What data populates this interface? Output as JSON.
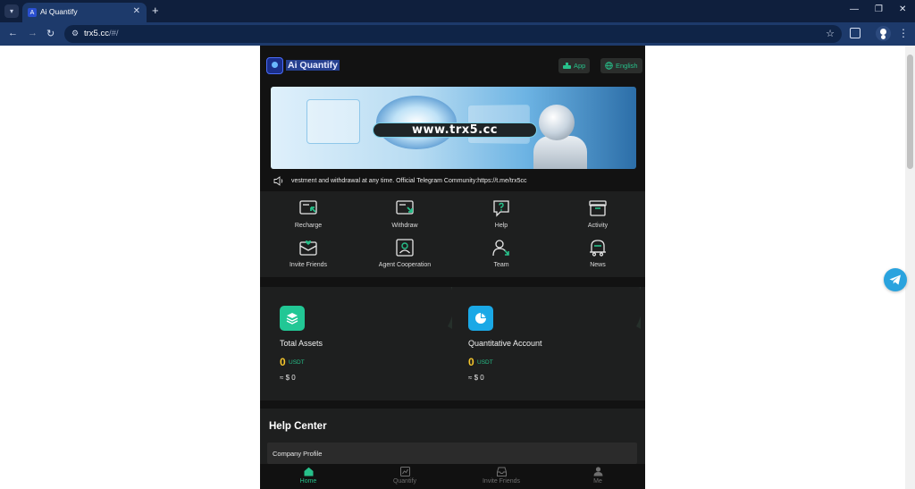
{
  "browser": {
    "tab_title": "Ai Quantify",
    "url_host": "trx5.cc",
    "url_path": "/#/",
    "new_tab": "+",
    "tab_close": "✕"
  },
  "header": {
    "brand": "Ai Quantify",
    "app_button": "App",
    "language_button": "English"
  },
  "banner": {
    "url_text": "www.trx5.cc"
  },
  "notice": {
    "text": "vestment and withdrawal at any time. Official Telegram Community:https://t.me/trx5cc"
  },
  "menu": {
    "items": [
      {
        "label": "Recharge",
        "icon": "recharge-icon"
      },
      {
        "label": "Withdraw",
        "icon": "withdraw-icon"
      },
      {
        "label": "Help",
        "icon": "help-icon"
      },
      {
        "label": "Activity",
        "icon": "activity-icon"
      },
      {
        "label": "Invite Friends",
        "icon": "invite-icon"
      },
      {
        "label": "Agent Cooperation",
        "icon": "agent-icon"
      },
      {
        "label": "Team",
        "icon": "team-icon"
      },
      {
        "label": "News",
        "icon": "news-icon"
      }
    ]
  },
  "assets": {
    "total": {
      "title": "Total Assets",
      "value": "0",
      "unit": "USDT",
      "approx": "≈ $ 0"
    },
    "quant": {
      "title": "Quantitative Account",
      "value": "0",
      "unit": "USDT",
      "approx": "≈ $ 0"
    }
  },
  "help_center": {
    "title": "Help Center",
    "rows": [
      "Company Profile"
    ]
  },
  "bottom_nav": {
    "items": [
      {
        "label": "Home",
        "active": true
      },
      {
        "label": "Quantify",
        "active": false
      },
      {
        "label": "Invite Friends",
        "active": false
      },
      {
        "label": "Me",
        "active": false
      }
    ]
  },
  "colors": {
    "accent_green": "#27c08a",
    "value_yellow": "#f5c52c",
    "app_bg": "#121212",
    "card_bg": "#1e1f1f",
    "browser_frame": "#0f1f3d",
    "telegram_blue": "#2aa3de"
  }
}
